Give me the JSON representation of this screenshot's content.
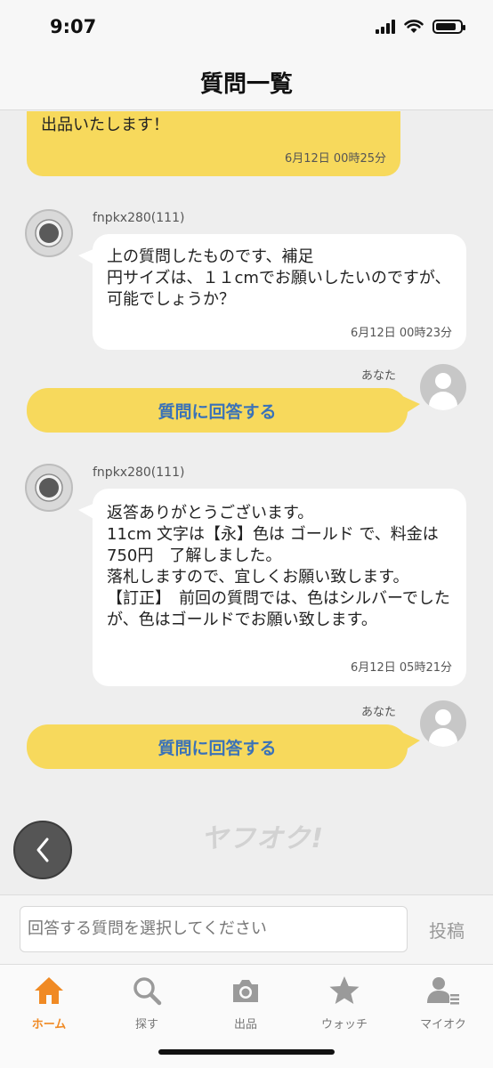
{
  "status_bar": {
    "time": "9:07"
  },
  "header": {
    "title": "質問一覧"
  },
  "messages": [
    {
      "type": "seller_reply",
      "text_top_partial": "",
      "text": "出品いたします！",
      "time": "6月12日 00時25分"
    },
    {
      "type": "question",
      "username": "fnpkx280(111)",
      "text": "上の質問したものです、補足\n円サイズは、１１cmでお願いしたいのですが、可能でしょうか？",
      "time": "6月12日 00時23分"
    },
    {
      "type": "answer_prompt",
      "you_label": "あなた",
      "button_label": "質問に回答する"
    },
    {
      "type": "question",
      "username": "fnpkx280(111)",
      "text": "返答ありがとうございます。\n11cm 文字は【永】色は ゴールド で、料金は 750円　了解しました。\n落札しますので、宜しくお願い致します。\n【訂正】　前回の質問では、色はシルバーでしたが、色はゴールドでお願い致します。",
      "time": "6月12日 05時21分"
    },
    {
      "type": "answer_prompt",
      "you_label": "あなた",
      "button_label": "質問に回答する"
    }
  ],
  "watermark": "ヤフオク!",
  "input": {
    "placeholder": "回答する質問を選択してください",
    "post_label": "投稿"
  },
  "tabs": [
    {
      "label": "ホーム",
      "icon": "home-icon",
      "active": true
    },
    {
      "label": "探す",
      "icon": "search-icon",
      "active": false
    },
    {
      "label": "出品",
      "icon": "camera-icon",
      "active": false
    },
    {
      "label": "ウォッチ",
      "icon": "star-icon",
      "active": false
    },
    {
      "label": "マイオク",
      "icon": "user-list-icon",
      "active": false
    }
  ],
  "colors": {
    "accent": "#f08a24",
    "bubble_yellow": "#f7d95c",
    "link_blue": "#3a72b8"
  }
}
